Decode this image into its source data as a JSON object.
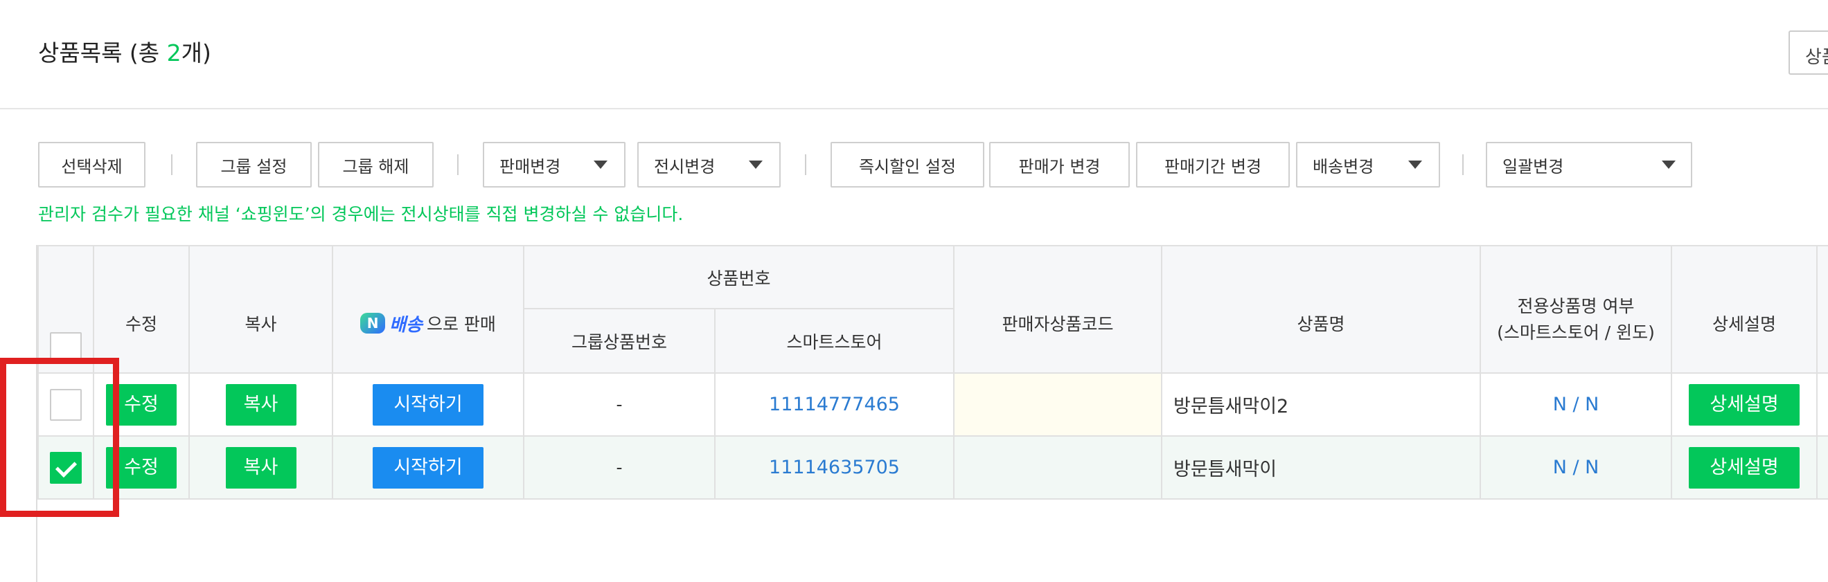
{
  "header": {
    "title_prefix": "상품목록 (총 ",
    "title_count": "2",
    "title_suffix": "개)",
    "right_button_label": "상품"
  },
  "toolbar": {
    "delete_selected": "선택삭제",
    "group_set": "그룹 설정",
    "group_unset": "그룹 해제",
    "sale_change": "판매변경",
    "display_change": "전시변경",
    "instant_discount": "즉시할인 설정",
    "price_change": "판매가 변경",
    "sale_period_change": "판매기간 변경",
    "shipping_change": "배송변경",
    "bulk_change": "일괄변경"
  },
  "notice": "관리자 검수가 필요한 채널 ‘쇼핑윈도’의 경우에는 전시상태를 직접 변경하실 수 없습니다.",
  "table": {
    "headers": {
      "edit": "수정",
      "copy": "복사",
      "naver_badge": "N",
      "naver_brand": "배송",
      "naver_suffix": "으로 판매",
      "product_number": "상품번호",
      "group_product_number": "그룹상품번호",
      "smartstore": "스마트스토어",
      "seller_code": "판매자상품코드",
      "product_name": "상품명",
      "exclusive_name_line1": "전용상품명 여부",
      "exclusive_name_line2": "(스마트스토어 / 윈도)",
      "detail": "상세설명"
    },
    "rows": [
      {
        "checked": false,
        "edit_label": "수정",
        "copy_label": "복사",
        "start_label": "시작하기",
        "group_number": "-",
        "smartstore_number": "11114777465",
        "seller_code": "",
        "product_name": "방문틈새막이2",
        "exclusive": "N / N",
        "detail_label": "상세설명"
      },
      {
        "checked": true,
        "edit_label": "수정",
        "copy_label": "복사",
        "start_label": "시작하기",
        "group_number": "-",
        "smartstore_number": "11114635705",
        "seller_code": "",
        "product_name": "방문틈새막이",
        "exclusive": "N / N",
        "detail_label": "상세설명"
      }
    ]
  },
  "colors": {
    "accent_green": "#03c75a",
    "link_blue": "#2a7bd1",
    "button_blue": "#1a8cf0",
    "highlight_red": "#e02020"
  }
}
